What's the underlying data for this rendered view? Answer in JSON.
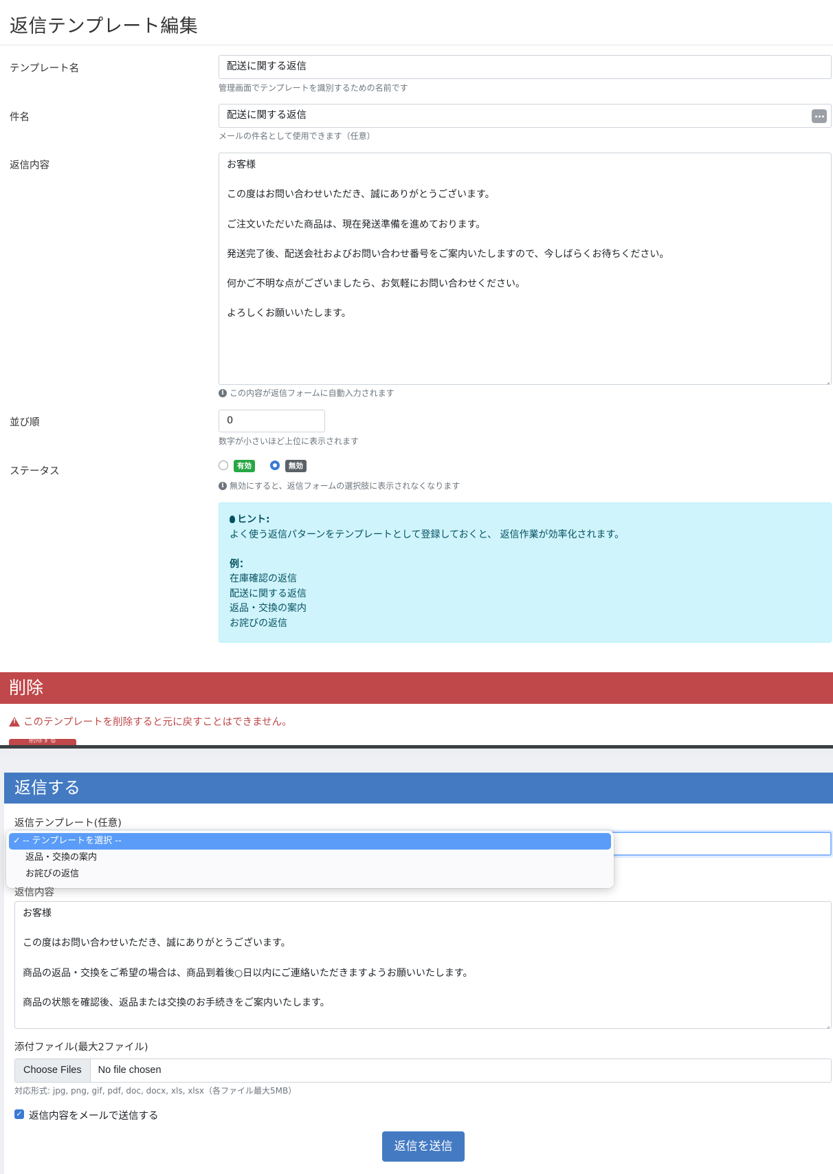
{
  "edit": {
    "title": "返信テンプレート編集",
    "fields": {
      "name": {
        "label": "テンプレート名",
        "value": "配送に関する返信",
        "help": "管理画面でテンプレートを識別するための名前です"
      },
      "subject": {
        "label": "件名",
        "value": "配送に関する返信",
        "help": "メールの件名として使用できます（任意）"
      },
      "body": {
        "label": "返信内容",
        "lines": [
          "お客様",
          "この度はお問い合わせいただき、誠にありがとうございます。",
          "ご注文いただいた商品は、現在発送準備を進めております。",
          "発送完了後、配送会社およびお問い合わせ番号をご案内いたしますので、今しばらくお待ちください。",
          "何かご不明な点がございましたら、お気軽にお問い合わせください。",
          "よろしくお願いいたします。"
        ],
        "help": "この内容が返信フォームに自動入力されます"
      },
      "order": {
        "label": "並び順",
        "value": "0",
        "help": "数字が小さいほど上位に表示されます"
      },
      "status": {
        "label": "ステータス",
        "options": [
          {
            "label": "有効",
            "checked": false,
            "color": "#28a745"
          },
          {
            "label": "無効",
            "checked": true,
            "color": "#5a6268"
          }
        ],
        "help": "無効にすると、返信フォームの選択肢に表示されなくなります"
      }
    },
    "hint": {
      "title": "ヒント:",
      "text": "よく使う返信パターンをテンプレートとして登録しておくと、 返信作業が効率化されます。",
      "example_title": "例：",
      "examples": [
        "在庫確認の返信",
        "配送に関する返信",
        "返品・交換の案内",
        "お詫びの返信"
      ]
    },
    "danger": {
      "title": "削除",
      "warning": "このテンプレートを削除すると元に戻すことはできません。",
      "button": "削除する"
    }
  },
  "reply": {
    "title": "返信する",
    "template_label": "返信テンプレート(任意)",
    "dropdown": [
      {
        "label": "-- テンプレートを選択 --",
        "selected": true
      },
      {
        "label": "返品・交換の案内",
        "selected": false
      },
      {
        "label": "お詫びの返信",
        "selected": false
      }
    ],
    "body_label": "返信内容",
    "body_lines": [
      "お客様",
      "この度はお問い合わせいただき、誠にありがとうございます。",
      "商品の返品・交換をご希望の場合は、商品到着後○日以内にご連絡いただきますようお願いいたします。",
      "商品の状態を確認後、返品または交換のお手続きをご案内いたします。"
    ],
    "attach_label": "添付ファイル(最大2ファイル)",
    "file_button": "Choose Files",
    "file_status": "No file chosen",
    "file_help": "対応形式: jpg, png, gif, pdf, doc, docx, xls, xlsx（各ファイル最大5MB）",
    "send_mail_label": "返信内容をメールで送信する",
    "send_mail_checked": true,
    "submit": "返信を送信"
  },
  "colors": {
    "primary": "#437ac2",
    "danger": "#c0484a",
    "info_bg": "#cff4fc",
    "info_text": "#055160"
  }
}
